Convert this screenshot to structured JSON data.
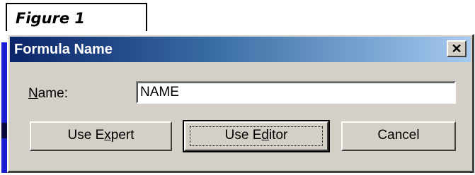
{
  "figure_label": "Figure 1",
  "window": {
    "title": "Formula Name",
    "close_symbol": "✕"
  },
  "form": {
    "name_label": "Name:",
    "name_value": "NAME"
  },
  "buttons": {
    "expert_label": "Use Expert",
    "editor_label": "Use Editor",
    "cancel_label": "Cancel"
  },
  "colors": {
    "frame_blue": "#1a1fd6",
    "title_gradient_start": "#0a246a",
    "title_gradient_end": "#a6caf0",
    "dialog_face": "#d4d0c8"
  },
  "icons": {
    "close": "close-icon"
  }
}
